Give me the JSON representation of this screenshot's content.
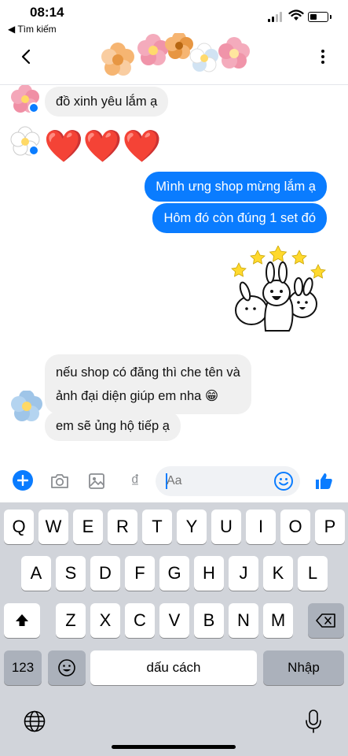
{
  "status_bar": {
    "time": "08:14",
    "back_app": "◀ Tìm kiếm"
  },
  "messages": {
    "incoming_1": "đồ xinh yêu lắm ạ",
    "hearts": [
      "❤️",
      "❤️",
      "❤️"
    ],
    "outgoing_1": "Mình ưng shop mừng lắm ạ",
    "outgoing_2": "Hôm đó còn đúng 1 set đó",
    "incoming_2_line1": "nếu shop có đăng thì che tên và",
    "incoming_2_line2": "ảnh đại diện giúp em nha 😁",
    "incoming_3": "em sẽ ủng hộ tiếp ạ"
  },
  "composer": {
    "placeholder": "Aa",
    "currency_symbol": "₫"
  },
  "keyboard": {
    "row1": [
      "Q",
      "W",
      "E",
      "R",
      "T",
      "Y",
      "U",
      "I",
      "O",
      "P"
    ],
    "row2": [
      "A",
      "S",
      "D",
      "F",
      "G",
      "H",
      "J",
      "K",
      "L"
    ],
    "row3": [
      "Z",
      "X",
      "C",
      "V",
      "B",
      "N",
      "M"
    ],
    "numbers_label": "123",
    "space_label": "dấu cách",
    "return_label": "Nhập"
  },
  "colors": {
    "accent": "#0a7cff",
    "incoming_bubble": "#f0f0f0",
    "keyboard_bg": "#d1d4da"
  },
  "icons": [
    "back-chevron-icon",
    "more-options-icon",
    "plus-icon",
    "camera-icon",
    "gallery-icon",
    "emoji-icon",
    "thumbs-up-icon",
    "shift-icon",
    "backspace-icon",
    "emoji-keyboard-icon",
    "globe-icon",
    "microphone-icon"
  ]
}
